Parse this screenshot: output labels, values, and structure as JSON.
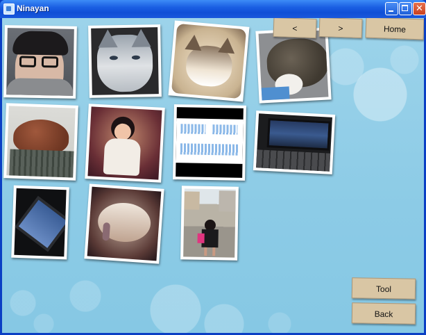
{
  "window": {
    "title": "Ninayan"
  },
  "nav": {
    "prev_label": "<",
    "next_label": ">",
    "home_label": "Home"
  },
  "actions": {
    "tool_label": "Tool",
    "back_label": "Back"
  }
}
